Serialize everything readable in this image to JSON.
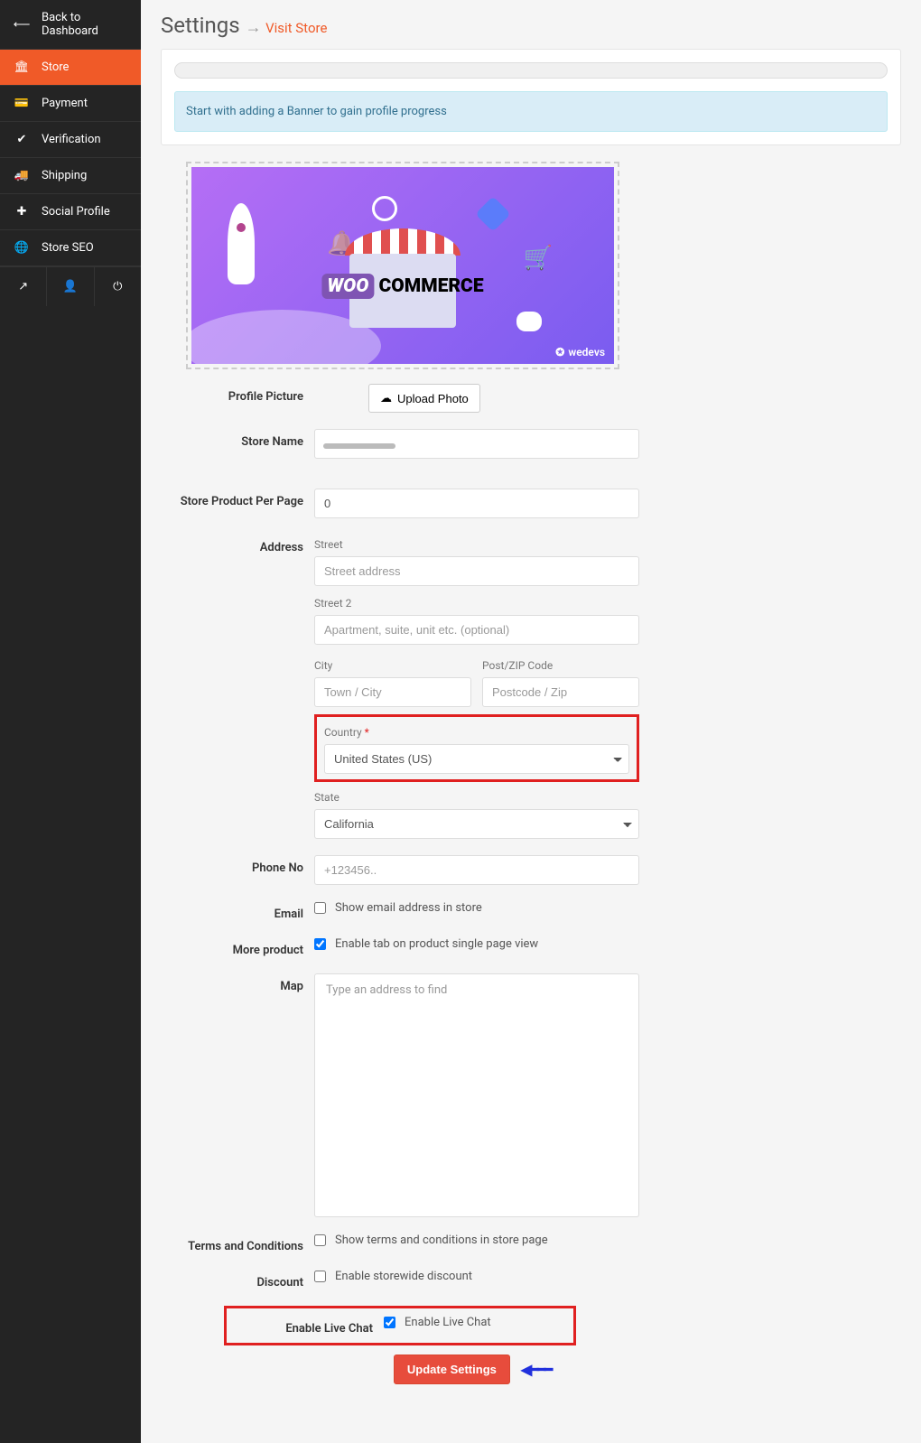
{
  "sidebar": {
    "back": "Back to Dashboard",
    "items": [
      {
        "label": "Store"
      },
      {
        "label": "Payment"
      },
      {
        "label": "Verification"
      },
      {
        "label": "Shipping"
      },
      {
        "label": "Social Profile"
      },
      {
        "label": "Store SEO"
      }
    ]
  },
  "header": {
    "title": "Settings",
    "visit": "Visit Store"
  },
  "alert": "Start with adding a Banner to gain profile progress",
  "banner_brand": "wedevs",
  "banner_logo_main": "WOO",
  "banner_logo_rest": " COMMERCE",
  "form": {
    "profile_picture_label": "Profile Picture",
    "upload_btn": "Upload Photo",
    "store_name_label": "Store Name",
    "store_name_value": "",
    "ppp_label": "Store Product Per Page",
    "ppp_value": "0",
    "address_label": "Address",
    "street_label": "Street",
    "street_ph": "Street address",
    "street2_label": "Street 2",
    "street2_ph": "Apartment, suite, unit etc. (optional)",
    "city_label": "City",
    "city_ph": "Town / City",
    "zip_label": "Post/ZIP Code",
    "zip_ph": "Postcode / Zip",
    "country_label": "Country",
    "country_value": "United States (US)",
    "state_label": "State",
    "state_value": "California",
    "phone_label": "Phone No",
    "phone_ph": "+123456..",
    "email_label": "Email",
    "email_chk": "Show email address in store",
    "more_label": "More product",
    "more_chk": "Enable tab on product single page view",
    "map_label": "Map",
    "map_ph": "Type an address to find",
    "tc_label": "Terms and Conditions",
    "tc_chk": "Show terms and conditions in store page",
    "discount_label": "Discount",
    "discount_chk": "Enable storewide discount",
    "livechat_label": "Enable Live Chat",
    "livechat_chk": "Enable Live Chat",
    "submit": "Update Settings"
  },
  "checkboxes": {
    "email": false,
    "more_product": true,
    "tc": false,
    "discount": false,
    "livechat": true
  }
}
